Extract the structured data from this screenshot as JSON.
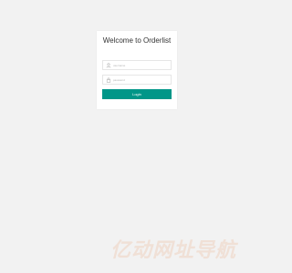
{
  "login": {
    "title": "Welcome to Orderlist",
    "username": {
      "placeholder": "username",
      "value": "",
      "icon": "user-icon"
    },
    "password": {
      "placeholder": "password",
      "value": "",
      "icon": "lock-icon"
    },
    "button_label": "Login",
    "accent_color": "#009688"
  },
  "watermark": {
    "text": "亿动网址导航",
    "color": "#f0e0d6"
  }
}
